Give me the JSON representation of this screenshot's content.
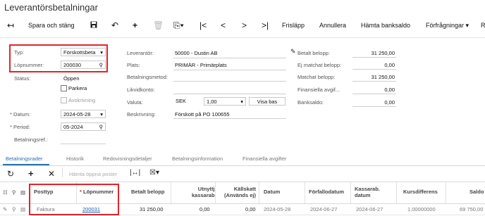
{
  "page": {
    "title": "Leverantörsbetalningar"
  },
  "toolbar": {
    "save_close": "Spara och stäng",
    "frislapp": "Frisläpp",
    "annullera": "Annullera",
    "hamta_banksaldo": "Hämta banksaldo",
    "forfragningar": "Förfrågningar ▾",
    "more": "R"
  },
  "form": {
    "typ_label": "Typ:",
    "typ_value": "Förskottsbeta",
    "lopnummer_label": "Löpnummer:",
    "lopnummer_value": "200030",
    "status_label": "Status:",
    "status_value": "Öppen",
    "parkera_label": "Parkera",
    "avskrivning_label": "Avskrivning",
    "datum_label": "Datum:",
    "datum_value": "2024-05-28",
    "period_label": "Period:",
    "period_value": "05-2024",
    "betalningsref_label": "Betalningsref.:",
    "leverantor_label": "Leverantör:",
    "leverantor_value": "50000 - Dustin AB",
    "plats_label": "Plats:",
    "plats_value": "PRIMÄR - Primärplats",
    "betalningsmetod_label": "Betalningsmetod:",
    "likvidkonto_label": "Likvidkonto:",
    "valuta_label": "Valuta:",
    "valuta_value": "SEK",
    "kurs_value": "1,00",
    "visa_bas": "Visa bas",
    "beskrivning_label": "Beskrivning:",
    "beskrivning_value": "Förskott på PO 100655",
    "betalt_belopp_label": "Betalt belopp:",
    "betalt_belopp_value": "31 250,00",
    "ej_matchat_label": "Ej matchat belopp:",
    "ej_matchat_value": "0,00",
    "matchat_label": "Matchat belopp:",
    "matchat_value": "31 250,00",
    "fin_avgift_label": "Finansiella avgif...",
    "fin_avgift_value": "0,00",
    "banksaldo_label": "Banksaldo:",
    "banksaldo_value": "0,00"
  },
  "tabs": [
    "Betalningsrader",
    "Historik",
    "Redovisningsdetaljer",
    "Betalningsinformation",
    "Finansiella avgifter"
  ],
  "grid": {
    "hamta_oppna_poster": "Hämta öppna poster",
    "headers": {
      "posttyp": "Posttyp",
      "lopnummer": "Löpnummer",
      "betalt_belopp": "Betalt belopp",
      "utnyttj_1": "Utnyttj.",
      "utnyttj_2": "kassarab.",
      "kallskatt_1": "Källskatt",
      "kallskatt_2": "(Används ej)",
      "datum": "Datum",
      "forfallodatum": "Förfallodatum",
      "kassarab_1": "Kassarab.",
      "kassarab_2": "datum",
      "kursdifferens": "Kursdifferens",
      "saldo": "Saldo"
    },
    "rows": [
      {
        "posttyp": "Faktura",
        "lopnummer": "200031",
        "betalt_belopp": "31 250,00",
        "utnyttj": "0,00",
        "kallskatt": "0,00",
        "datum": "2024-05-28",
        "forfallodatum": "2024-06-27",
        "kassarab_datum": "2024-06-27",
        "kursdifferens": "1,00000000",
        "saldo": "69 750,00"
      }
    ]
  }
}
